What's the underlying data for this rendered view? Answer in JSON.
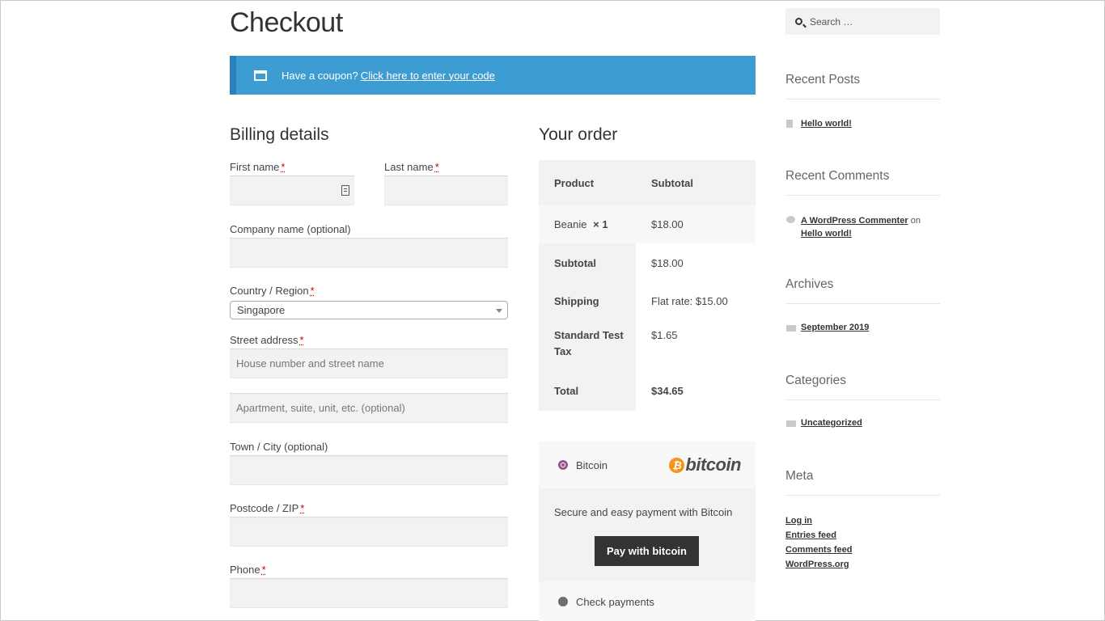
{
  "page": {
    "title": "Checkout"
  },
  "coupon": {
    "text": "Have a coupon?",
    "link": "Click here to enter your code"
  },
  "billing": {
    "heading": "Billing details",
    "required_marker": "*",
    "first_name_label": "First name",
    "last_name_label": "Last name",
    "company_label": "Company name (optional)",
    "country_label": "Country / Region",
    "country_value": "Singapore",
    "street_label": "Street address",
    "street_placeholder": "House number and street name",
    "street2_placeholder": "Apartment, suite, unit, etc. (optional)",
    "city_label": "Town / City (optional)",
    "postcode_label": "Postcode / ZIP",
    "phone_label": "Phone"
  },
  "order": {
    "heading": "Your order",
    "col_product": "Product",
    "col_subtotal": "Subtotal",
    "item_name": "Beanie",
    "item_qty": "× 1",
    "item_price": "$18.00",
    "subtotal_label": "Subtotal",
    "subtotal_value": "$18.00",
    "shipping_label": "Shipping",
    "shipping_value": "Flat rate: $15.00",
    "tax_label": "Standard Test Tax",
    "tax_value": "$1.65",
    "total_label": "Total",
    "total_value": "$34.65"
  },
  "payment": {
    "bitcoin_label": "Bitcoin",
    "bitcoin_logo_text": "bitcoin",
    "bitcoin_coin_glyph": "₿",
    "bitcoin_desc": "Secure and easy payment with Bitcoin",
    "pay_button": "Pay with bitcoin",
    "check_label": "Check payments"
  },
  "sidebar": {
    "search_placeholder": "Search …",
    "recent_posts_title": "Recent Posts",
    "recent_post_1": "Hello world!",
    "recent_comments_title": "Recent Comments",
    "comment_author": "A WordPress Commenter",
    "comment_on": "on",
    "comment_post": "Hello world!",
    "archives_title": "Archives",
    "archive_1": "September 2019",
    "categories_title": "Categories",
    "category_1": "Uncategorized",
    "meta_title": "Meta",
    "meta_login": "Log in",
    "meta_entries": "Entries feed",
    "meta_comments": "Comments feed",
    "meta_wordpress": "WordPress.org"
  },
  "colors": {
    "coupon_bg": "#3d9cd2",
    "button_bg": "#333333",
    "radio_accent": "#96588a",
    "bitcoin_orange": "#f7931a"
  }
}
